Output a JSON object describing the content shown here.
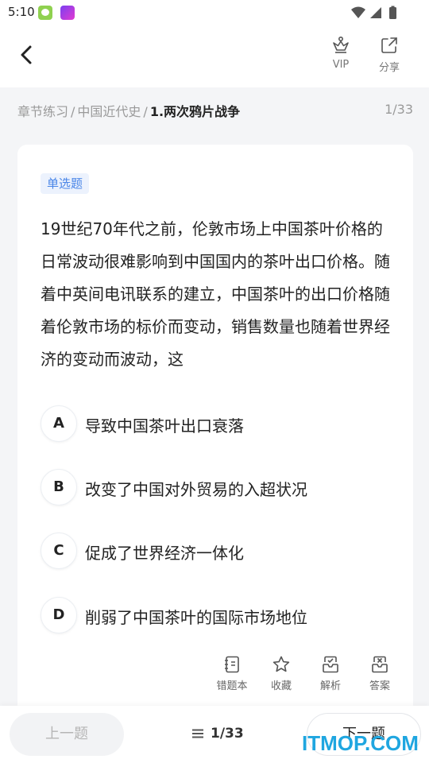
{
  "status_bar": {
    "time": "5:10",
    "icons": [
      "app-icon",
      "app-icon",
      "wifi-icon",
      "signal-icon",
      "battery-icon"
    ]
  },
  "header": {
    "back_icon": "chevron-left-icon",
    "actions": [
      {
        "label": "VIP",
        "icon": "crown-icon"
      },
      {
        "label": "分享",
        "icon": "share-icon"
      }
    ]
  },
  "breadcrumb": {
    "items": [
      "章节练习",
      "中国近代史",
      "1.两次鸦片战争"
    ],
    "separator": "/",
    "count": "1/33"
  },
  "question": {
    "type_tag": "单选题",
    "stem": "19世纪70年代之前，伦敦市场上中国茶叶价格的日常波动很难影响到中国国内的茶叶出口价格。随着中英间电讯联系的建立，中国茶叶的出口价格随着伦敦市场的标价而变动，销售数量也随着世界经济的变动而波动，这",
    "options": [
      {
        "letter": "A",
        "text": "导致中国茶叶出口衰落"
      },
      {
        "letter": "B",
        "text": "改变了中国对外贸易的入超状况"
      },
      {
        "letter": "C",
        "text": "促成了世界经济一体化"
      },
      {
        "letter": "D",
        "text": "削弱了中国茶叶的国际市场地位"
      }
    ]
  },
  "tools": [
    {
      "label": "错题本",
      "icon": "notebook-icon"
    },
    {
      "label": "收藏",
      "icon": "star-icon"
    },
    {
      "label": "解析",
      "icon": "analysis-icon"
    },
    {
      "label": "答案",
      "icon": "answer-icon"
    }
  ],
  "bottom": {
    "prev_label": "上一题",
    "progress": "1/33",
    "next_label": "下一题"
  },
  "watermark": "ITMOP.COM",
  "colors": {
    "accent": "#4a86e8",
    "tag_bg": "#ecf2fd",
    "page_bg": "#f4f5f7",
    "watermark": "#1fa6e0"
  }
}
